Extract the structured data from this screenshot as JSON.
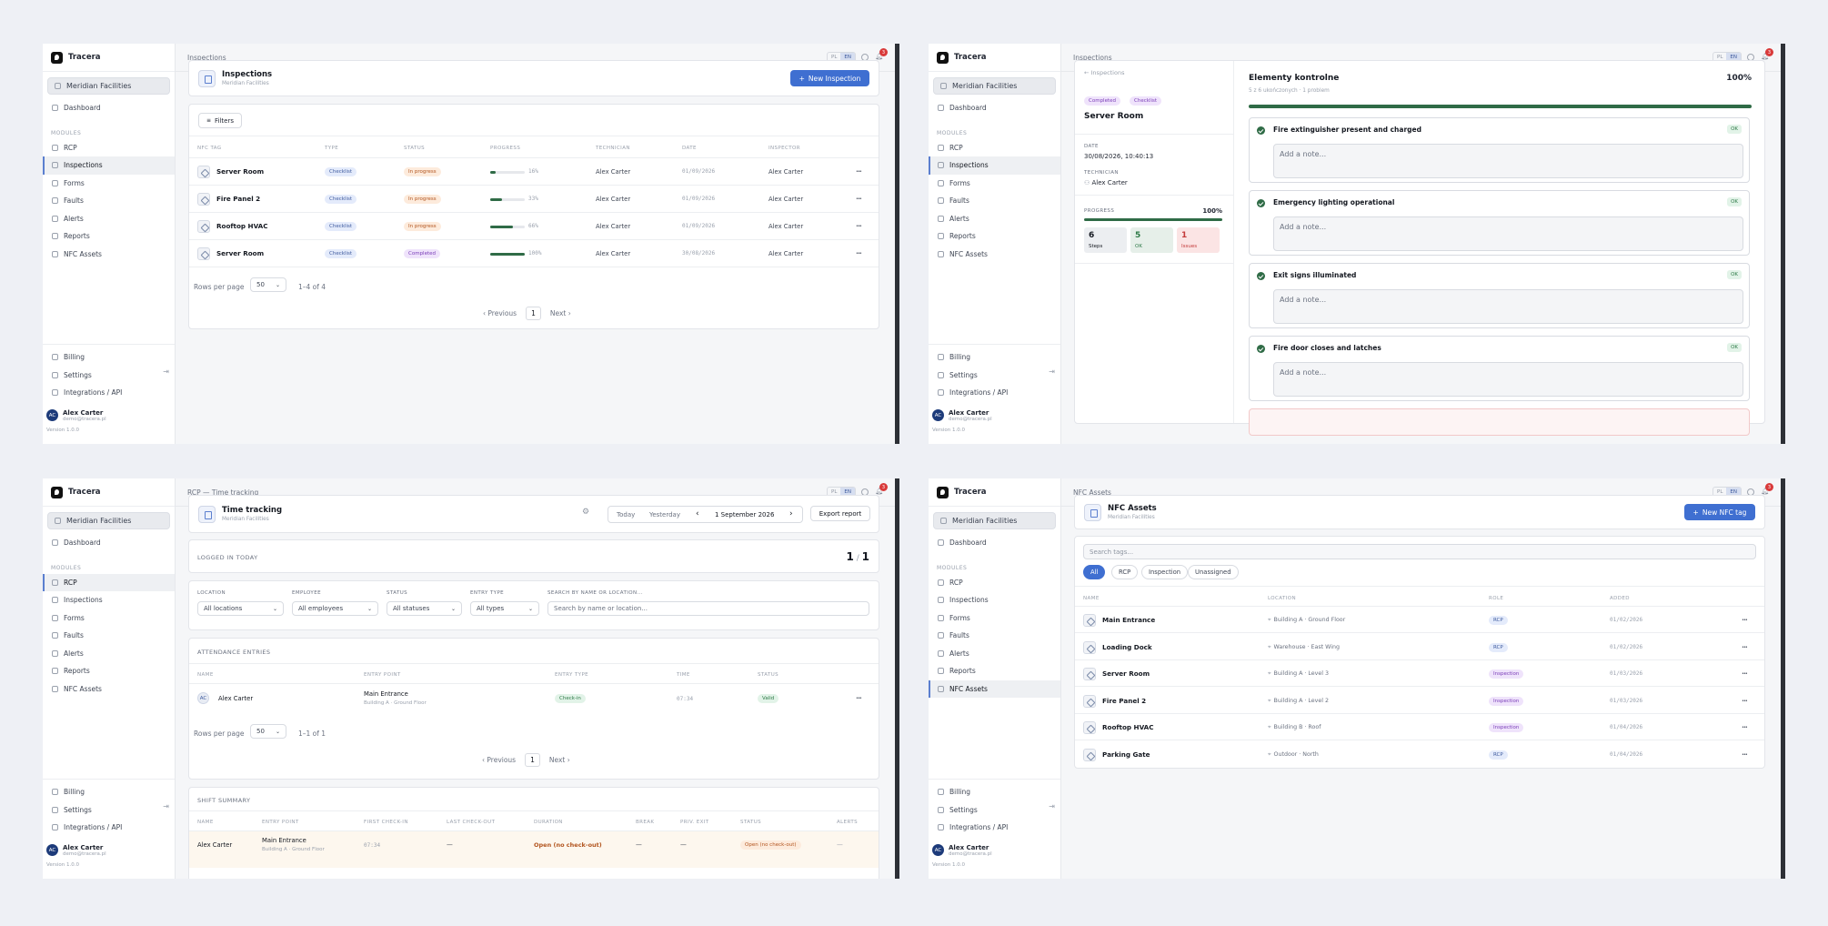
{
  "app": {
    "name": "Tracera",
    "org": "Meridian Facilities"
  },
  "nav": {
    "dashboard": "Dashboard",
    "modules_label": "MODULES",
    "modules": [
      "RCP",
      "Inspections",
      "Forms",
      "Faults",
      "Alerts",
      "Reports",
      "NFC Assets"
    ],
    "bottom": [
      "Billing",
      "Settings",
      "Integrations / API"
    ]
  },
  "user": {
    "initials": "AC",
    "name": "Alex Carter",
    "email": "demo@tracera.pl",
    "version": "Version 1.0.0"
  },
  "topbar": {
    "lang_pl": "PL",
    "lang_en": "EN",
    "notif_count": "3"
  },
  "inspections": {
    "breadcrumb": "Inspections",
    "title": "Inspections",
    "subtitle": "Meridian Facilities",
    "new_button": "New Inspection",
    "filters": "Filters",
    "columns": [
      "NFC TAG",
      "TYPE",
      "STATUS",
      "PROGRESS",
      "TECHNICIAN",
      "DATE",
      "INSPECTOR"
    ],
    "rows": [
      {
        "tag": "Server Room",
        "type": "Checklist",
        "status": "In progress",
        "progress": 16,
        "progress_label": "16%",
        "technician": "Alex Carter",
        "date": "01/09/2026",
        "inspector": "Alex Carter"
      },
      {
        "tag": "Fire Panel 2",
        "type": "Checklist",
        "status": "In progress",
        "progress": 33,
        "progress_label": "33%",
        "technician": "Alex Carter",
        "date": "01/09/2026",
        "inspector": "Alex Carter"
      },
      {
        "tag": "Rooftop HVAC",
        "type": "Checklist",
        "status": "In progress",
        "progress": 66,
        "progress_label": "66%",
        "technician": "Alex Carter",
        "date": "01/09/2026",
        "inspector": "Alex Carter"
      },
      {
        "tag": "Server Room",
        "type": "Checklist",
        "status": "Completed",
        "progress": 100,
        "progress_label": "100%",
        "technician": "Alex Carter",
        "date": "30/08/2026",
        "inspector": "Alex Carter"
      }
    ],
    "rows_per_page_label": "Rows per page",
    "rows_per_page": "50",
    "range": "1–4 of 4",
    "prev": "Previous",
    "page": "1",
    "next": "Next"
  },
  "detail": {
    "breadcrumb": "Inspections",
    "back": "Inspections",
    "status": "Completed",
    "type": "Checklist",
    "title": "Server Room",
    "date_label": "DATE",
    "date": "30/08/2026, 10:40:13",
    "tech_label": "TECHNICIAN",
    "technician": "Alex Carter",
    "progress_label": "PROGRESS",
    "progress": "100%",
    "stats": [
      {
        "value": "6",
        "label": "Steps"
      },
      {
        "value": "5",
        "label": "OK"
      },
      {
        "value": "1",
        "label": "Issues"
      }
    ],
    "section_title": "Elementy kontrolne",
    "section_sub": "5 z 6 ukończonych · 1 problem",
    "section_pct": "100%",
    "note_placeholder": "Add a note...",
    "ok": "OK",
    "items": [
      "Fire extinguisher present and charged",
      "Emergency lighting operational",
      "Exit signs illuminated",
      "Fire door closes and latches"
    ]
  },
  "rcp": {
    "breadcrumb": "RCP — Time tracking",
    "title": "Time tracking",
    "subtitle": "Meridian Facilities",
    "today": "Today",
    "yesterday": "Yesterday",
    "date": "1 September 2026",
    "export": "Export report",
    "logged_label": "LOGGED IN TODAY",
    "logged_count": "1",
    "logged_total": "1",
    "filters": {
      "location_label": "LOCATION",
      "location": "All locations",
      "employee_label": "EMPLOYEE",
      "employee": "All employees",
      "status_label": "STATUS",
      "status": "All statuses",
      "entry_label": "ENTRY TYPE",
      "entry": "All types",
      "search_label": "SEARCH BY NAME OR LOCATION...",
      "search_placeholder": "Search by name or location..."
    },
    "entries_label": "ATTENDANCE ENTRIES",
    "entries_cols": [
      "NAME",
      "ENTRY POINT",
      "ENTRY TYPE",
      "TIME",
      "STATUS"
    ],
    "entry": {
      "initials": "AC",
      "name": "Alex Carter",
      "point": "Main Entrance",
      "point_sub": "Building A · Ground Floor",
      "type": "Check-in",
      "time": "07:34",
      "status": "Valid"
    },
    "rows_per_page_label": "Rows per page",
    "rows_per_page": "50",
    "range": "1–1 of 1",
    "prev": "Previous",
    "page": "1",
    "next": "Next",
    "summary_label": "SHIFT SUMMARY",
    "summary_cols": [
      "NAME",
      "ENTRY POINT",
      "FIRST CHECK-IN",
      "LAST CHECK-OUT",
      "DURATION",
      "BREAK",
      "PRIV. EXIT",
      "STATUS",
      "ALERTS"
    ],
    "summary": {
      "name": "Alex Carter",
      "point": "Main Entrance",
      "point_sub": "Building A · Ground Floor",
      "first": "07:34",
      "last": "—",
      "duration": "Open (no check-out)",
      "break": "—",
      "priv": "—",
      "status": "Open (no check-out)",
      "alerts": "—"
    }
  },
  "nfc": {
    "breadcrumb": "NFC Assets",
    "title": "NFC Assets",
    "subtitle": "Meridian Facilities",
    "new_button": "New NFC tag",
    "search_placeholder": "Search tags...",
    "chips": [
      "All",
      "RCP",
      "Inspection",
      "Unassigned"
    ],
    "columns": [
      "NAME",
      "LOCATION",
      "ROLE",
      "ADDED"
    ],
    "rows": [
      {
        "name": "Main Entrance",
        "location": "Building A · Ground Floor",
        "role": "RCP",
        "added": "01/02/2026"
      },
      {
        "name": "Loading Dock",
        "location": "Warehouse · East Wing",
        "role": "RCP",
        "added": "01/02/2026"
      },
      {
        "name": "Server Room",
        "location": "Building A · Level 3",
        "role": "Inspection",
        "added": "01/03/2026"
      },
      {
        "name": "Fire Panel 2",
        "location": "Building A · Level 2",
        "role": "Inspection",
        "added": "01/03/2026"
      },
      {
        "name": "Rooftop HVAC",
        "location": "Building B · Roof",
        "role": "Inspection",
        "added": "01/04/2026"
      },
      {
        "name": "Parking Gate",
        "location": "Outdoor · North",
        "role": "RCP",
        "added": "01/04/2026"
      }
    ]
  }
}
